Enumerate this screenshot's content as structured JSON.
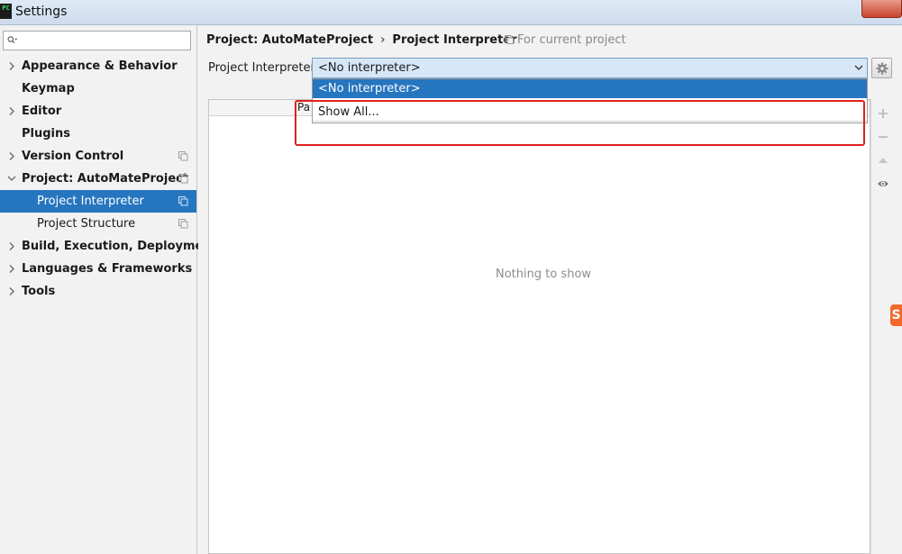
{
  "window": {
    "title": "Settings",
    "icon_text": "PC",
    "colors": {
      "selection": "#2675bf",
      "highlight_border": "#e02020"
    }
  },
  "sidebar": {
    "search": {
      "value": "",
      "placeholder": ""
    },
    "items": [
      {
        "label": "Appearance & Behavior",
        "expandable": true,
        "expanded": false
      },
      {
        "label": "Keymap",
        "expandable": false
      },
      {
        "label": "Editor",
        "expandable": true,
        "expanded": false
      },
      {
        "label": "Plugins",
        "expandable": false
      },
      {
        "label": "Version Control",
        "expandable": true,
        "expanded": false,
        "project_scope": true
      },
      {
        "label": "Project: AutoMateProject",
        "expandable": true,
        "expanded": true,
        "project_scope": true
      },
      {
        "label": "Project Interpreter",
        "child": true,
        "selected": true,
        "project_scope": true
      },
      {
        "label": "Project Structure",
        "child": true,
        "project_scope": true
      },
      {
        "label": "Build, Execution, Deployment",
        "expandable": true,
        "expanded": false
      },
      {
        "label": "Languages & Frameworks",
        "expandable": true,
        "expanded": false
      },
      {
        "label": "Tools",
        "expandable": true,
        "expanded": false
      }
    ]
  },
  "main": {
    "breadcrumb": {
      "parent": "Project: AutoMateProject",
      "separator": "›",
      "current": "Project Interpreter"
    },
    "scope_note": "For current project",
    "interpreter": {
      "label": "Project Interpreter:",
      "selected": "<No interpreter>",
      "options": [
        "<No interpreter>",
        "Show All..."
      ]
    },
    "table": {
      "column_header_fragment": "Pa",
      "empty_text": "Nothing to show"
    },
    "tools": [
      "add-icon",
      "remove-icon",
      "upgrade-icon",
      "eye-icon"
    ]
  },
  "overlay": {
    "logo_letter": "S"
  }
}
